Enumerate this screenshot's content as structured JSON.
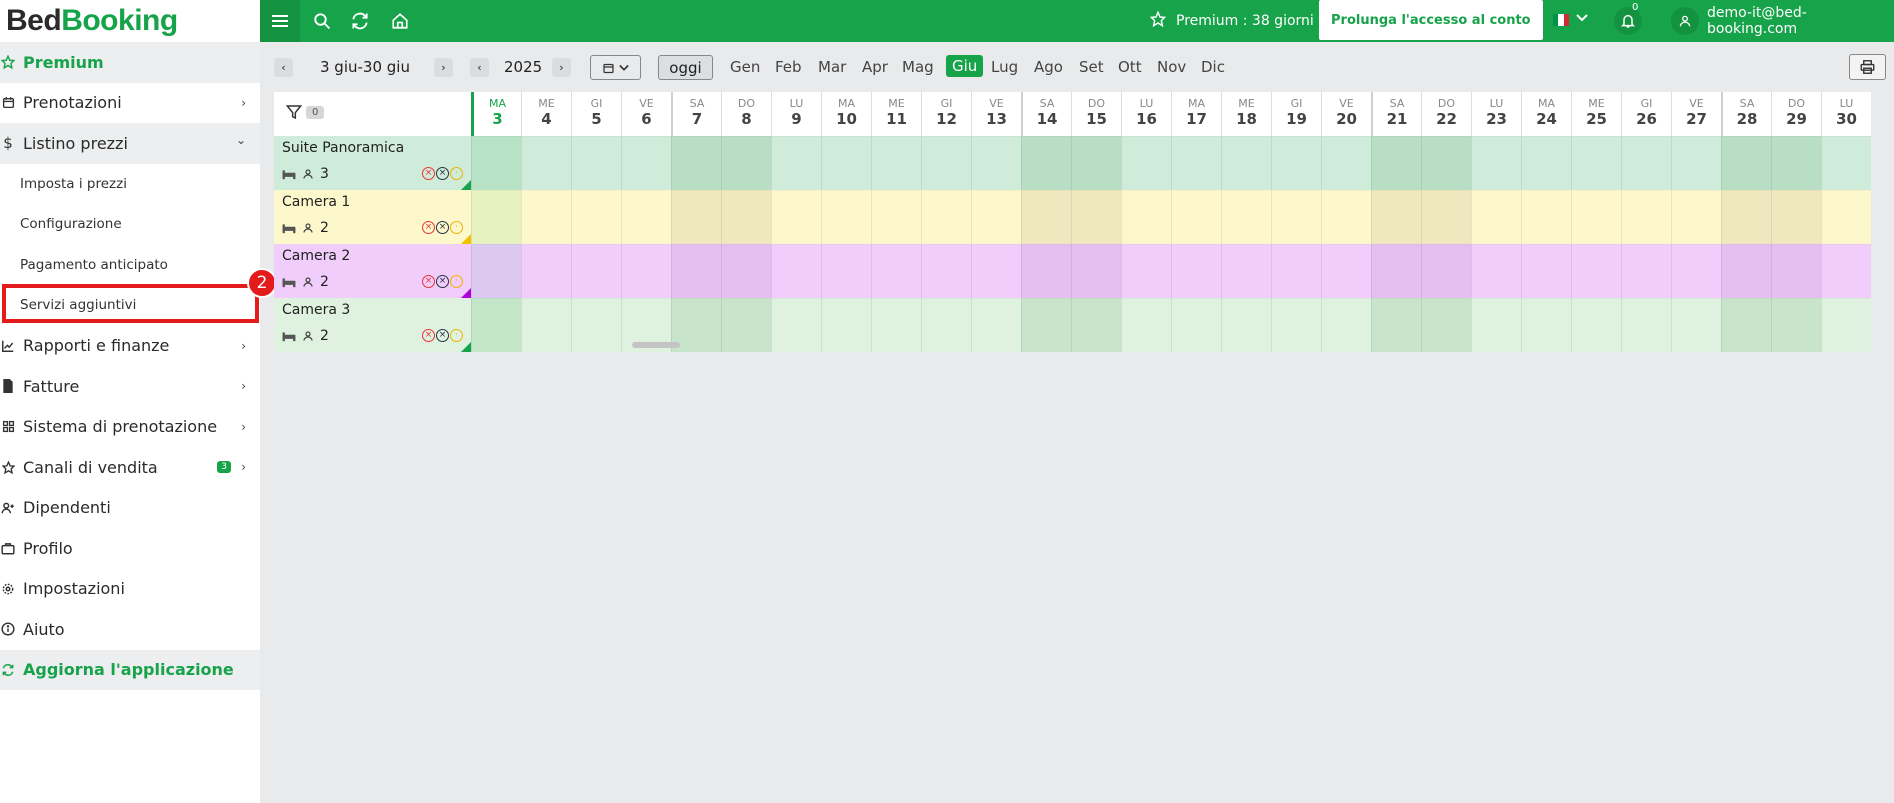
{
  "logo": {
    "part1": "Bed",
    "part2": "Booking"
  },
  "sidebar": {
    "premium": "Premium",
    "items": [
      {
        "label": "Prenotazioni",
        "icon": "calendar-icon",
        "chevron": "›"
      },
      {
        "label": "Listino prezzi",
        "icon": "dollar-icon",
        "chevron": "⌄"
      },
      {
        "label": "Rapporti e finanze",
        "icon": "chart-icon",
        "chevron": "›"
      },
      {
        "label": "Fatture",
        "icon": "invoice-icon",
        "chevron": "›"
      },
      {
        "label": "Sistema di prenotazione",
        "icon": "grid-icon",
        "chevron": "›"
      },
      {
        "label": "Canali di vendita",
        "icon": "star-icon",
        "chevron": "›",
        "badge": "3"
      },
      {
        "label": "Dipendenti",
        "icon": "user-plus-icon"
      },
      {
        "label": "Profilo",
        "icon": "briefcase-icon"
      },
      {
        "label": "Impostazioni",
        "icon": "gear-icon"
      },
      {
        "label": "Aiuto",
        "icon": "info-icon"
      }
    ],
    "subitems": [
      "Imposta i prezzi",
      "Configurazione",
      "Pagamento anticipato",
      "Servizi aggiuntivi"
    ],
    "update": "Aggiorna l'applicazione",
    "step_badge": "2"
  },
  "topbar": {
    "premium": "Premium : 38 giorni",
    "extend": "Prolunga l'accesso al conto",
    "notif_count": "0",
    "email": "demo-it@bed-booking.com"
  },
  "toolbar": {
    "range": "3 giu-30 giu",
    "year": "2025",
    "today": "oggi",
    "months": [
      "Gen",
      "Feb",
      "Mar",
      "Apr",
      "Mag",
      "Giu",
      "Lug",
      "Ago",
      "Set",
      "Ott",
      "Nov",
      "Dic"
    ],
    "active_month": "Giu"
  },
  "grid": {
    "filter_count": "0",
    "days": [
      {
        "dow": "MA",
        "num": "3"
      },
      {
        "dow": "ME",
        "num": "4"
      },
      {
        "dow": "GI",
        "num": "5"
      },
      {
        "dow": "VE",
        "num": "6"
      },
      {
        "dow": "SA",
        "num": "7"
      },
      {
        "dow": "DO",
        "num": "8"
      },
      {
        "dow": "LU",
        "num": "9"
      },
      {
        "dow": "MA",
        "num": "10"
      },
      {
        "dow": "ME",
        "num": "11"
      },
      {
        "dow": "GI",
        "num": "12"
      },
      {
        "dow": "VE",
        "num": "13"
      },
      {
        "dow": "SA",
        "num": "14"
      },
      {
        "dow": "DO",
        "num": "15"
      },
      {
        "dow": "LU",
        "num": "16"
      },
      {
        "dow": "MA",
        "num": "17"
      },
      {
        "dow": "ME",
        "num": "18"
      },
      {
        "dow": "GI",
        "num": "19"
      },
      {
        "dow": "VE",
        "num": "20"
      },
      {
        "dow": "SA",
        "num": "21"
      },
      {
        "dow": "DO",
        "num": "22"
      },
      {
        "dow": "LU",
        "num": "23"
      },
      {
        "dow": "MA",
        "num": "24"
      },
      {
        "dow": "ME",
        "num": "25"
      },
      {
        "dow": "GI",
        "num": "26"
      },
      {
        "dow": "VE",
        "num": "27"
      },
      {
        "dow": "SA",
        "num": "28"
      },
      {
        "dow": "DO",
        "num": "29"
      },
      {
        "dow": "LU",
        "num": "30"
      }
    ],
    "rooms": [
      {
        "name": "Suite Panoramica",
        "guests": "3",
        "bg": "#cfebd9",
        "bg_first": "#b7e2c5",
        "bg_weekend": "#b8dec4",
        "corner": "#16a34a"
      },
      {
        "name": "Camera 1",
        "guests": "2",
        "bg": "#fdf7cc",
        "bg_first": "#e7f2c2",
        "bg_weekend": "#efe8be",
        "corner": "#f2c200"
      },
      {
        "name": "Camera 2",
        "guests": "2",
        "bg": "#f1cdfb",
        "bg_first": "#dbc9f1",
        "bg_weekend": "#e4bff0",
        "corner": "#b100e0"
      },
      {
        "name": "Camera 3",
        "guests": "2",
        "bg": "#def2df",
        "bg_first": "#c3e6c9",
        "bg_weekend": "#c8e4cb",
        "corner": "#16a34a"
      }
    ]
  }
}
